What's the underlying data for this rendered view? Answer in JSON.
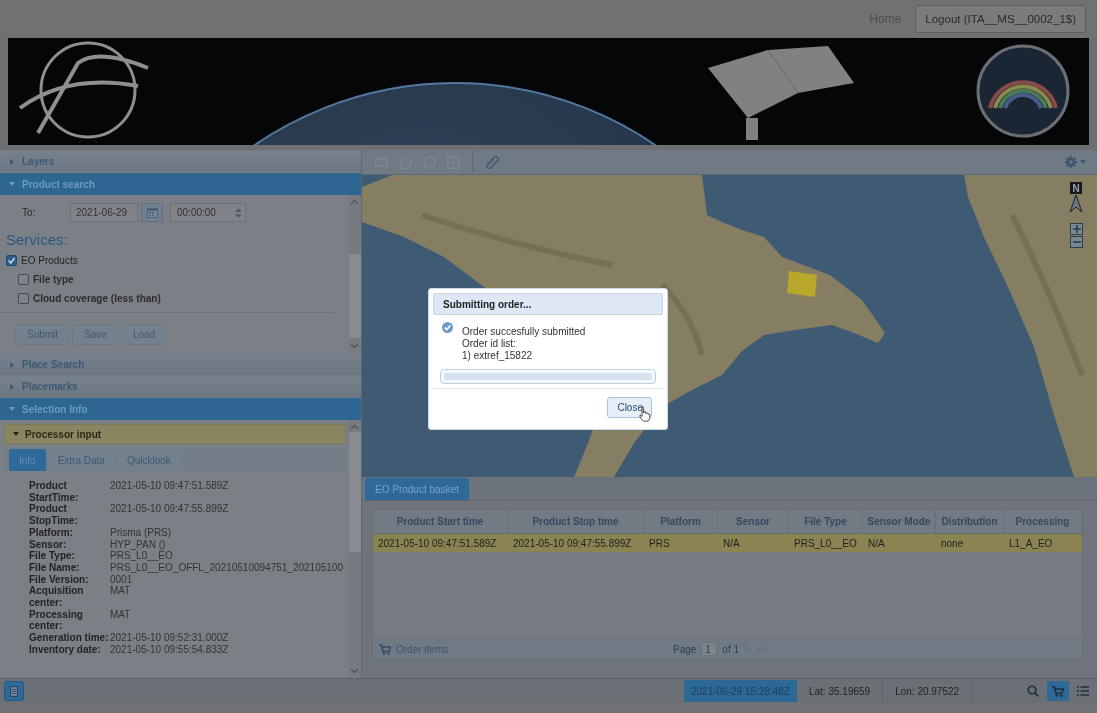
{
  "header": {
    "links": [
      {
        "kind": "link",
        "label": "Home"
      },
      {
        "kind": "button",
        "label": "Logout (ITA__MS__0002_1$)"
      }
    ]
  },
  "left_panel": {
    "sections": [
      {
        "kind": "plain",
        "title": "Layers",
        "expanded": false
      },
      {
        "kind": "search",
        "title": "Product search",
        "expanded": true,
        "to_label": "To:",
        "date": "2021-06-29",
        "time": "00:00:00",
        "services_heading": "Services:",
        "services": [
          {
            "label": "EO Products",
            "checked": true,
            "children": [
              {
                "label": "File type",
                "checked": false
              },
              {
                "label": "Cloud coverage (less than)",
                "checked": false
              }
            ]
          }
        ],
        "buttons": [
          "Submit",
          "Save",
          "Load"
        ]
      },
      {
        "kind": "plain",
        "title": "Place Search",
        "expanded": false
      },
      {
        "kind": "plain",
        "title": "Placemarks",
        "expanded": false
      },
      {
        "kind": "selection",
        "title": "Selection Info",
        "expanded": true,
        "panel": {
          "title": "Processor input",
          "expanded": true,
          "tabs": [
            {
              "label": "Info",
              "selected": true
            },
            {
              "label": "Extra Data",
              "selected": false
            },
            {
              "label": "Quicklook",
              "selected": false
            }
          ],
          "fields": [
            {
              "label": "Product StartTime:",
              "value": "2021-05-10 09:47:51.589Z"
            },
            {
              "label": "Product StopTime:",
              "value": "2021-05-10 09:47:55.899Z"
            },
            {
              "label": "Platform:",
              "value": "Prisma (PRS)"
            },
            {
              "label": "Sensor:",
              "value": "HYP_PAN ()"
            },
            {
              "label": "File Type:",
              "value": "PRS_L0__EO"
            },
            {
              "label": "File Name:",
              "value": "PRS_L0__EO_OFFL_20210510094751_202105100"
            },
            {
              "label": "File Version:",
              "value": "0001"
            },
            {
              "label": "Acquisition center:",
              "value": "MAT"
            },
            {
              "label": "Processing center:",
              "value": "MAT"
            },
            {
              "label": "Generation time:",
              "value": "2021-05-10 09:52:31.000Z"
            },
            {
              "label": "Inventory date:",
              "value": "2021-05-10 09:55:54.833Z"
            }
          ]
        }
      }
    ]
  },
  "map": {
    "tools": [
      {
        "disabled": true
      },
      {
        "disabled": true
      },
      {
        "disabled": true
      },
      {
        "disabled": true
      },
      {
        "disabled": false
      }
    ],
    "compass_label": "N"
  },
  "basket": {
    "tab": {
      "label": "EO Product basket",
      "selected": true
    },
    "columns": [
      "Product Start time",
      "Product Stop time",
      "Platform",
      "Sensor",
      "File Type",
      "Sensor Mode",
      "Distribution",
      "Processing"
    ],
    "rows": [
      {
        "selected": true,
        "cells": [
          "2021-05-10 09:47:51.589Z",
          "2021-05-10 09:47:55.899Z",
          "PRS",
          "N/A",
          "PRS_L0__EO",
          "N/A",
          "none",
          "L1_A_EO"
        ]
      }
    ],
    "order_button": "Order items",
    "pager": {
      "label": "Page",
      "value": "1",
      "total": "of 1"
    }
  },
  "status_bar": {
    "time": "2021-06-29 15:28:48Z",
    "lat": "Lat: 35.19659",
    "lon": "Lon: 20.97522",
    "tools": [
      {
        "selected": false
      },
      {
        "selected": true
      },
      {
        "selected": false
      }
    ]
  },
  "dialog": {
    "title": "Submitting order...",
    "lines": [
      "Order succesfully submitted",
      "Order id list:",
      "1) extref_15822"
    ],
    "progress": {
      "level": 1
    },
    "button": "Close"
  }
}
